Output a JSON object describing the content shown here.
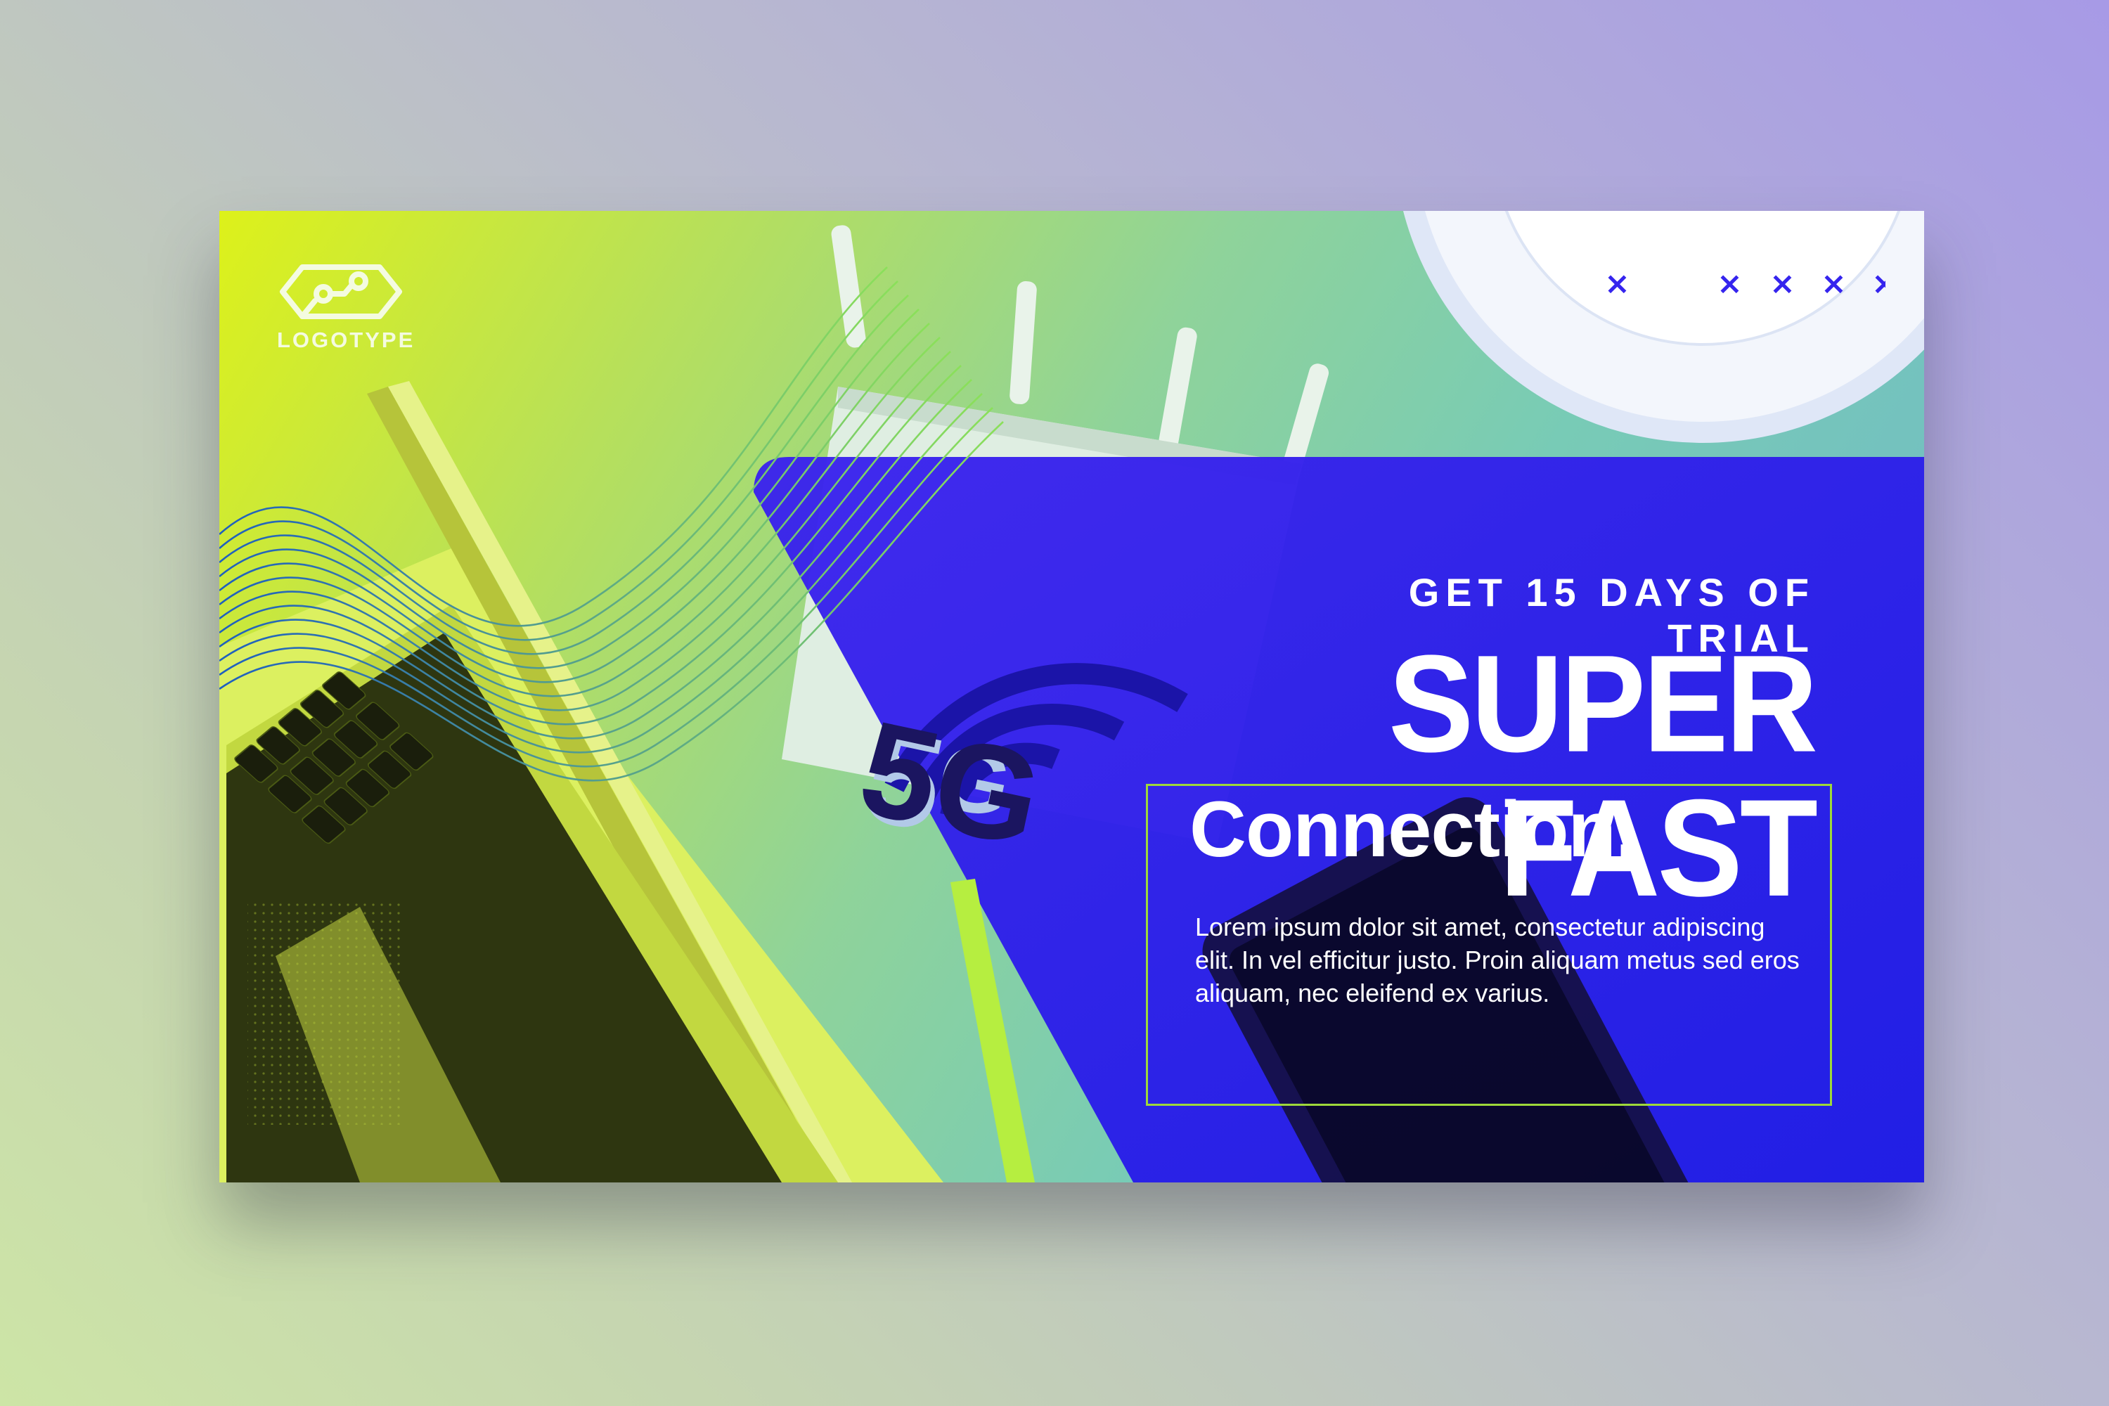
{
  "banner": {
    "logo": {
      "icon": "hexagon-circuit-icon",
      "text": "LOGOTYPE"
    },
    "decorations": {
      "x_marks": [
        "×",
        "×",
        "×",
        "×",
        "×"
      ],
      "badge_text": "5G",
      "signal_icon": "wifi-signal-icon"
    },
    "trial_text": "GET 15 DAYS OF TRIAL",
    "headline": "SUPER FAST",
    "subheadline": "Connection.",
    "body": "Lorem ipsum dolor sit amet, consectetur adipiscing elit. In vel efficitur justo. Proin aliquam metus sed eros aliquam, nec eleifend ex varius."
  },
  "colors": {
    "accent_blue": "#2a1ff0",
    "accent_green": "#9ed83a",
    "lime": "#ddf11a",
    "text": "#ffffff"
  }
}
